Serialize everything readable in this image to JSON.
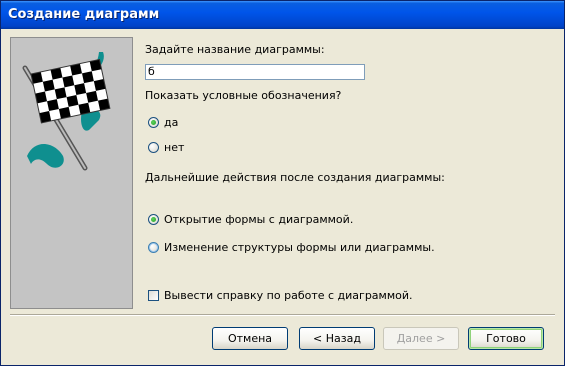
{
  "window": {
    "title": "Создание диаграмм"
  },
  "form": {
    "name_label": "Задайте название диаграммы:",
    "name_value": "б",
    "legend_label": "Показать условные обозначения?",
    "legend_yes": "да",
    "legend_yes_selected": true,
    "legend_no": "нет",
    "next_actions_label": "Дальнейшие действия после создания диаграммы:",
    "open_form": "Открытие формы с диаграммой.",
    "open_form_selected": true,
    "edit_structure": "Изменение структуры формы или диаграммы.",
    "help_checkbox": "Вывести справку по работе с диаграммой.",
    "help_checked": false
  },
  "buttons": {
    "cancel": "Отмена",
    "back": "< Назад",
    "next": "Далее >",
    "next_enabled": false,
    "finish": "Готово"
  },
  "colors": {
    "titlebar": "#0055ea",
    "flag_swoosh": "#0f8f8f",
    "picture_bg": "#c4c4c4"
  },
  "icons": {
    "picture": "checkered-flag-icon"
  }
}
